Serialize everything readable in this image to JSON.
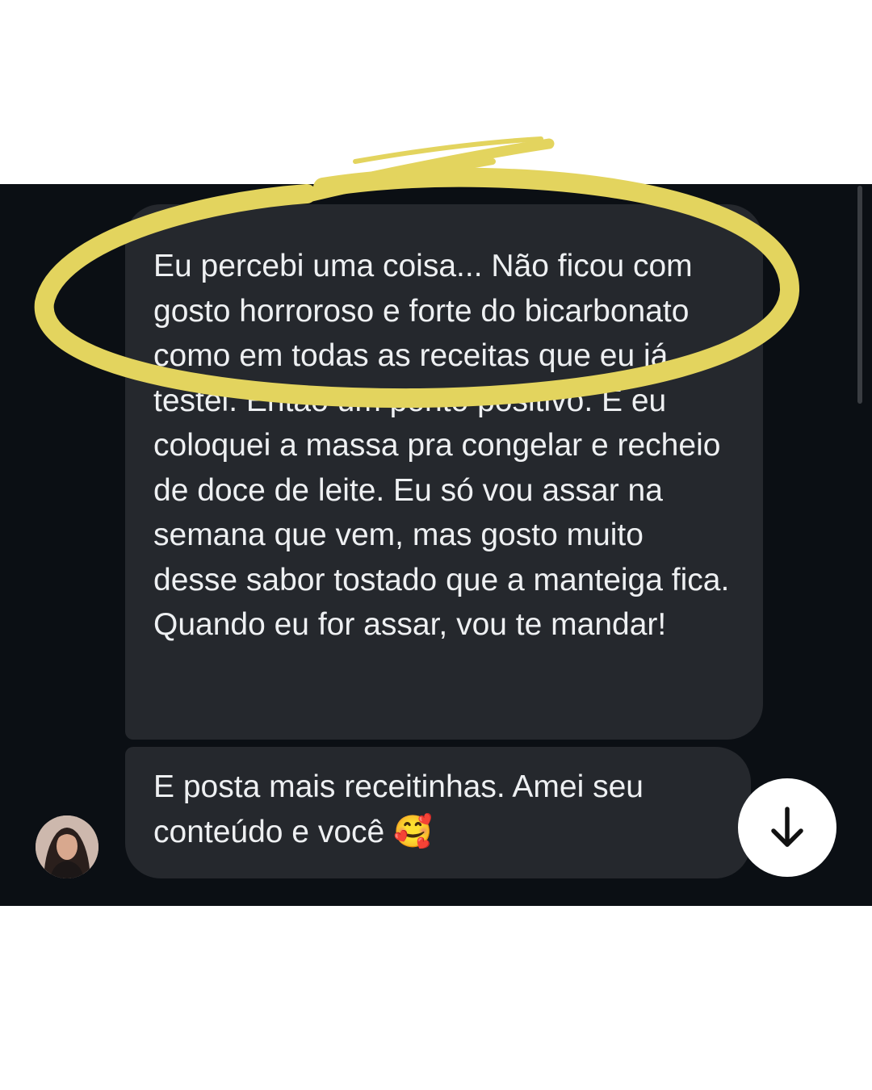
{
  "messages": [
    {
      "text": "Eu percebi uma coisa... Não ficou com gosto horroroso e forte do bicarbonato como em todas as receitas que eu já testei. Então um ponto positivo. E eu coloquei a massa pra congelar e recheio de doce de leite. Eu só vou assar na semana que vem, mas gosto muito desse sabor tostado que a manteiga fica. Quando eu for assar, vou te mandar!"
    },
    {
      "text": "E posta mais receitinhas. Amei seu conteúdo e você 🥰"
    }
  ],
  "icons": {
    "scroll_button": "arrow-down-icon",
    "avatar": "profile-photo"
  },
  "colors": {
    "background": "#0b0f14",
    "bubble": "#25282d",
    "text": "#eef0f2",
    "highlight": "#e3d45e"
  }
}
